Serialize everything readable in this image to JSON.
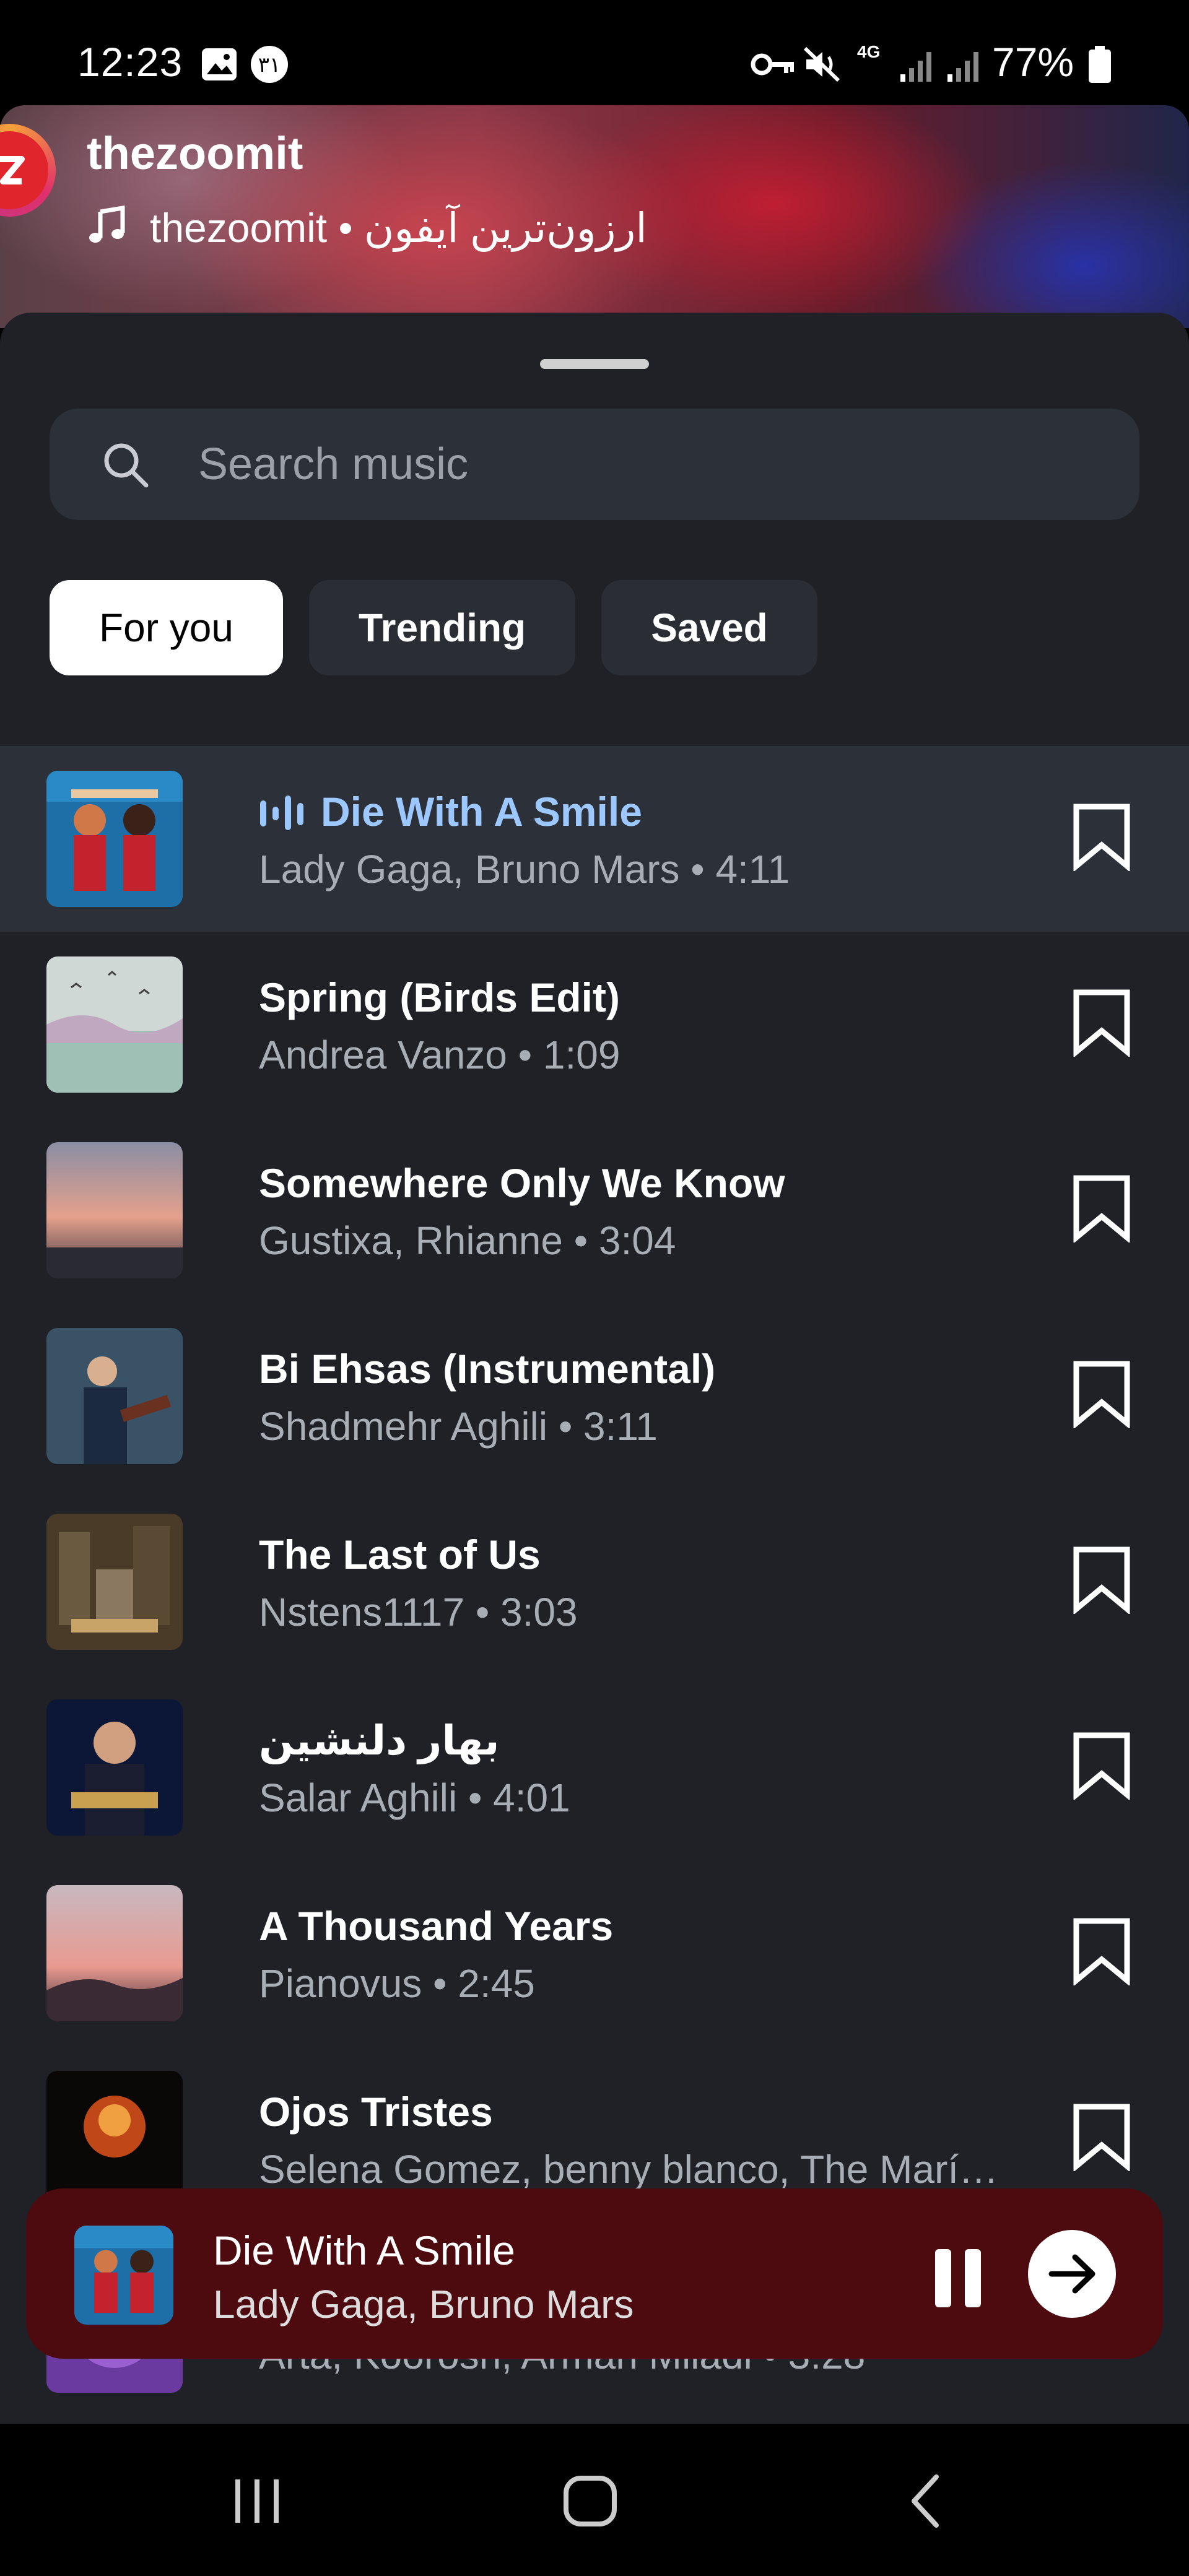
{
  "status_bar": {
    "time": "12:23",
    "battery": "77%",
    "network": "4G"
  },
  "story": {
    "username": "thezoomit",
    "music_line": "thezoomit • ارزون‌ترین آیفون"
  },
  "search": {
    "placeholder": "Search music",
    "value": ""
  },
  "tabs": [
    {
      "label": "For you",
      "active": true
    },
    {
      "label": "Trending",
      "active": false
    },
    {
      "label": "Saved",
      "active": false
    }
  ],
  "tracks": [
    {
      "title": "Die With A Smile",
      "subtitle": "Lady Gaga, Bruno Mars • 4:11",
      "playing": true
    },
    {
      "title": "Spring (Birds Edit)",
      "subtitle": "Andrea Vanzo • 1:09",
      "playing": false
    },
    {
      "title": "Somewhere Only We Know",
      "subtitle": "Gustixa, Rhianne • 3:04",
      "playing": false
    },
    {
      "title": "Bi Ehsas (Instrumental)",
      "subtitle": "Shadmehr Aghili • 3:11",
      "playing": false
    },
    {
      "title": "The Last of Us",
      "subtitle": "Nstens1117 • 3:03",
      "playing": false
    },
    {
      "title": "بهار دلنشین",
      "subtitle": "Salar Aghili • 4:01",
      "playing": false
    },
    {
      "title": "A Thousand Years",
      "subtitle": "Pianovus • 2:45",
      "playing": false
    },
    {
      "title": "Ojos Tristes",
      "subtitle": "Selena Gomez, benny blanco, The Marí…",
      "playing": false
    },
    {
      "title": "",
      "subtitle": "Arta, Koorosh, Arman Miladi • 3:28",
      "playing": false
    }
  ],
  "now_playing": {
    "title": "Die With A Smile",
    "artist": "Lady Gaga, Bruno Mars"
  },
  "colors": {
    "sheet_bg": "#1f2126",
    "active_row_bg": "#2c3039",
    "active_title": "#9cc7ff",
    "mini_player_bg": "#4d0b10"
  }
}
